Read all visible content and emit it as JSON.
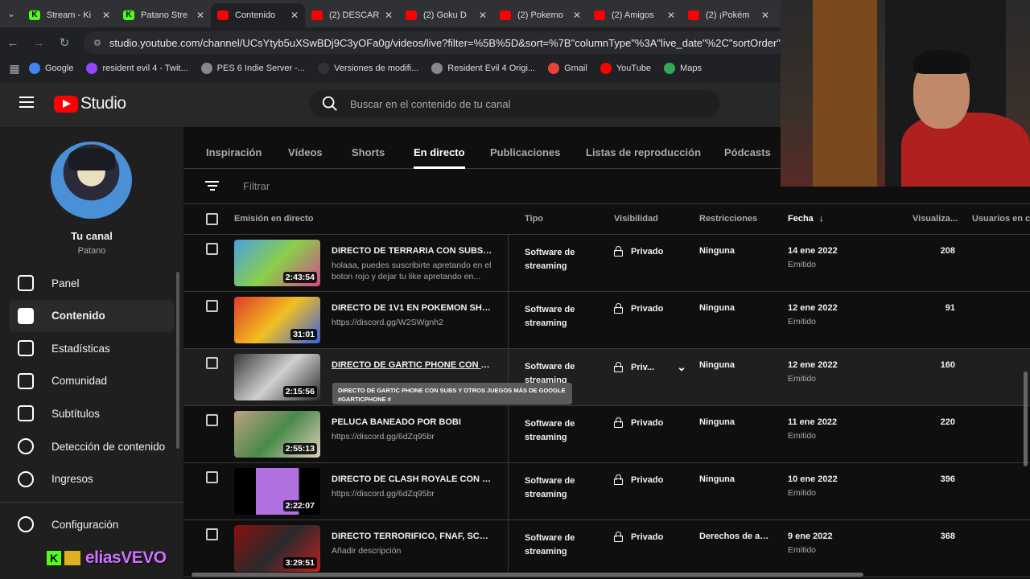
{
  "browser": {
    "tabs": [
      {
        "label": "Stream - Ki",
        "fav": "kick",
        "active": false
      },
      {
        "label": "Patano Stre",
        "fav": "kick",
        "active": false
      },
      {
        "label": "Contenido",
        "fav": "yt",
        "active": true
      },
      {
        "label": "(2) DESCAR",
        "fav": "yt",
        "active": false
      },
      {
        "label": "(2) Goku D",
        "fav": "yt",
        "active": false
      },
      {
        "label": "(2) Pokemo",
        "fav": "yt",
        "active": false
      },
      {
        "label": "(2) Amigos",
        "fav": "yt",
        "active": false
      },
      {
        "label": "(2) ¡Pokém",
        "fav": "yt",
        "active": false
      }
    ],
    "url": "studio.youtube.com/channel/UCsYtyb5uXSwBDj9C3yOFa0g/videos/live?filter=%5B%5D&sort=%7B\"columnType\"%3A\"live_date\"%2C\"sortOrder\"%3A\"DE",
    "bookmarks": [
      {
        "label": "Google",
        "color": "#4285f4"
      },
      {
        "label": "resident evil 4 - Twit...",
        "color": "#9146ff"
      },
      {
        "label": "PES 6 Indie Server -...",
        "color": "#888888"
      },
      {
        "label": "Versiones de modifi...",
        "color": "#333333"
      },
      {
        "label": "Resident Evil 4 Origi...",
        "color": "#888888"
      },
      {
        "label": "Gmail",
        "color": "#ea4335"
      },
      {
        "label": "YouTube",
        "color": "#ff0000"
      },
      {
        "label": "Maps",
        "color": "#34a853"
      }
    ]
  },
  "header": {
    "logo_text": "Studio",
    "search_placeholder": "Buscar en el contenido de tu canal"
  },
  "sidebar": {
    "channel_title": "Tu canal",
    "channel_handle": "Patano",
    "items": [
      {
        "label": "Panel",
        "icon": "dashboard-icon",
        "active": false
      },
      {
        "label": "Contenido",
        "icon": "content-icon",
        "active": true
      },
      {
        "label": "Estadísticas",
        "icon": "analytics-icon",
        "active": false
      },
      {
        "label": "Comunidad",
        "icon": "community-icon",
        "active": false
      },
      {
        "label": "Subtítulos",
        "icon": "subtitles-icon",
        "active": false
      },
      {
        "label": "Detección de contenido",
        "icon": "copyright-icon",
        "active": false
      },
      {
        "label": "Ingresos",
        "icon": "monetization-icon",
        "active": false
      }
    ],
    "settings_label": "Configuración",
    "overlay_name": "eliasVEVO"
  },
  "content_tabs": [
    "Inspiración",
    "Vídeos",
    "Shorts",
    "En directo",
    "Publicaciones",
    "Listas de reproducción",
    "Pódcasts"
  ],
  "active_tab": "En directo",
  "filter_placeholder": "Filtrar",
  "columns": {
    "stream": "Emisión en directo",
    "type": "Tipo",
    "visibility": "Visibilidad",
    "restrictions": "Restricciones",
    "date": "Fecha",
    "views": "Visualiza...",
    "users": "Usuarios en c"
  },
  "rows": [
    {
      "title": "DIRECTO DE TERRARIA CON SUBS, N...",
      "desc": "holaaa, puedes suscribirte apretando en el boton rojo y dejar tu like apretando en...",
      "duration": "2:43:54",
      "type": "Software de streaming",
      "visibility": "Privado",
      "restrictions": "Ninguna",
      "date": "14 ene 2022",
      "status": "Emitido",
      "views": "208",
      "thumb": "linear-gradient(135deg,#4aa0e0,#8ad04a 50%,#d04a8a)"
    },
    {
      "title": "DIRECTO DE 1V1 EN POKEMON SHO...",
      "desc": "https://discord.gg/W2SWgnh2",
      "duration": "31:01",
      "type": "Software de streaming",
      "visibility": "Privado",
      "restrictions": "Ninguna",
      "date": "12 ene 2022",
      "status": "Emitido",
      "views": "91",
      "thumb": "linear-gradient(135deg,#e03a2a,#f0c020 50%,#3a60e0)"
    },
    {
      "title": "DIRECTO DE GARTIC PHONE CON SU...",
      "desc": "",
      "duration": "2:15:56",
      "type": "Software de streaming",
      "visibility": "Priv...",
      "restrictions": "Ninguna",
      "date": "12 ene 2022",
      "status": "Emitido",
      "views": "160",
      "thumb": "linear-gradient(135deg,#3a3a3a,#d0d0d0 50%,#2a2a2a)"
    },
    {
      "title": "PELUCA BANEADO POR BOBI",
      "desc": "https://discord.gg/6dZq95br",
      "duration": "2:55:13",
      "type": "Software de streaming",
      "visibility": "Privado",
      "restrictions": "Ninguna",
      "date": "11 ene 2022",
      "status": "Emitido",
      "views": "220",
      "thumb": "linear-gradient(135deg,#c0a080,#4a8a4a 50%,#e0d0c0)"
    },
    {
      "title": "DIRECTO DE CLASH ROYALE CON SU...",
      "desc": "https://discord.gg/6dZq95br",
      "duration": "2:22:07",
      "type": "Software de streaming",
      "visibility": "Privado",
      "restrictions": "Ninguna",
      "date": "10 ene 2022",
      "status": "Emitido",
      "views": "396",
      "thumb": "linear-gradient(90deg,#000 25%,#b070e0 25% 75%,#000 75%)"
    },
    {
      "title": "DIRECTO TERRORIFICO, FNAF, SCP Y ...",
      "desc": "Añadir descripción",
      "duration": "3:29:51",
      "type": "Software de streaming",
      "visibility": "Privado",
      "restrictions": "Derechos de au...",
      "date": "9 ene 2022",
      "status": "Emitido",
      "views": "368",
      "thumb": "linear-gradient(135deg,#8a1010,#2a2a2a 50%,#c02020)"
    }
  ],
  "tooltip": "DIRECTO DE GARTIC PHONE CON SUBS Y OTROS JUEGOS MÁS DE GOOGLE #GARTICPHONE #"
}
